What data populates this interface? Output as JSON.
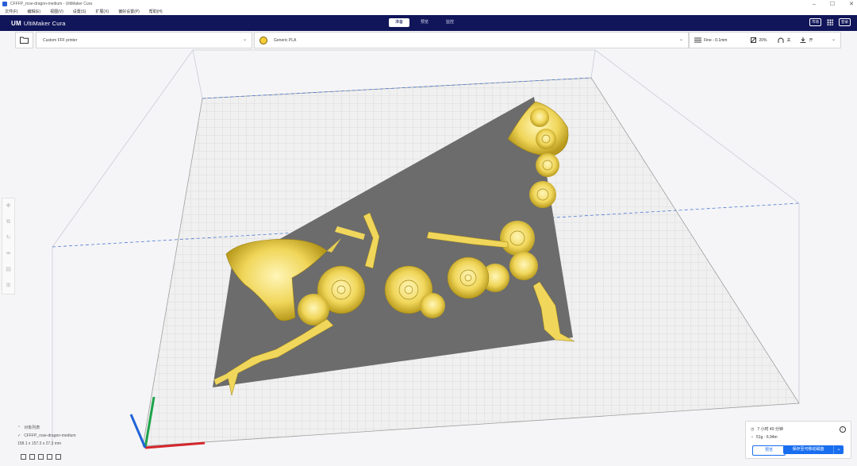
{
  "window": {
    "title": "CFFFP_rose-dragon-medium - UltiMaker Cura",
    "controls": [
      "–",
      "☐",
      "✕"
    ]
  },
  "menu": [
    "文件(F)",
    "编辑(E)",
    "视图(V)",
    "设置(S)",
    "扩展(X)",
    "偏好设置(P)",
    "帮助(H)"
  ],
  "header": {
    "logo_mark": "UM",
    "logo": "UltiMaker Cura",
    "stages": [
      {
        "label": "准备",
        "active": true
      },
      {
        "label": "预览",
        "active": false
      },
      {
        "label": "监控",
        "active": false
      }
    ],
    "marketplace": "市场",
    "account": "登录"
  },
  "toolbar": {
    "printer": "Custom FFF printer",
    "material": "Generic PLA",
    "profile": "Fine - 0.1mm",
    "infill": "20%",
    "support": "关",
    "adhesion": "开"
  },
  "object": {
    "list_label": "对象列表",
    "name": "CFFFP_rose-dragon-medium",
    "dimensions": "158.1 x 157.3 x 27.3 mm"
  },
  "estimate": {
    "time": "7 小时 40 分钟",
    "material": "51g · 6.94m",
    "preview_label": "预览",
    "save_label": "保存至可移动磁盘"
  },
  "colors": {
    "header_bg": "#11165a",
    "accent": "#196ef0",
    "model": "#f2dc6a",
    "build_plate": "#f0f0f0",
    "shadow": "#6e6e6e"
  }
}
